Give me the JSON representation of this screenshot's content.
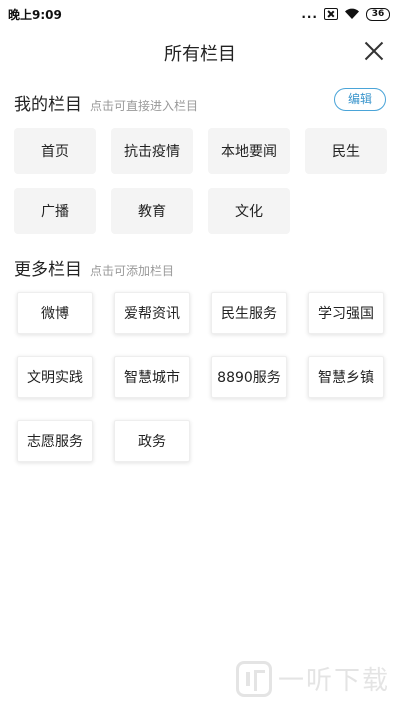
{
  "status_bar": {
    "time": "晚上9:09",
    "signal_dots": "...",
    "battery": "36"
  },
  "header": {
    "title": "所有栏目"
  },
  "my_channels": {
    "title": "我的栏目",
    "hint": "点击可直接进入栏目",
    "edit_label": "编辑",
    "items": [
      "首页",
      "抗击疫情",
      "本地要闻",
      "民生",
      "广播",
      "教育",
      "文化"
    ]
  },
  "more_channels": {
    "title": "更多栏目",
    "hint": "点击可添加栏目",
    "items": [
      "微博",
      "爱帮资讯",
      "民生服务",
      "学习强国",
      "文明实践",
      "智慧城市",
      "8890服务",
      "智慧乡镇",
      "志愿服务",
      "政务"
    ]
  },
  "watermark": {
    "text": "一听下载"
  },
  "colors": {
    "accent": "#3a95cc",
    "chip_bg": "#f4f4f4",
    "hint_text": "#999999"
  }
}
